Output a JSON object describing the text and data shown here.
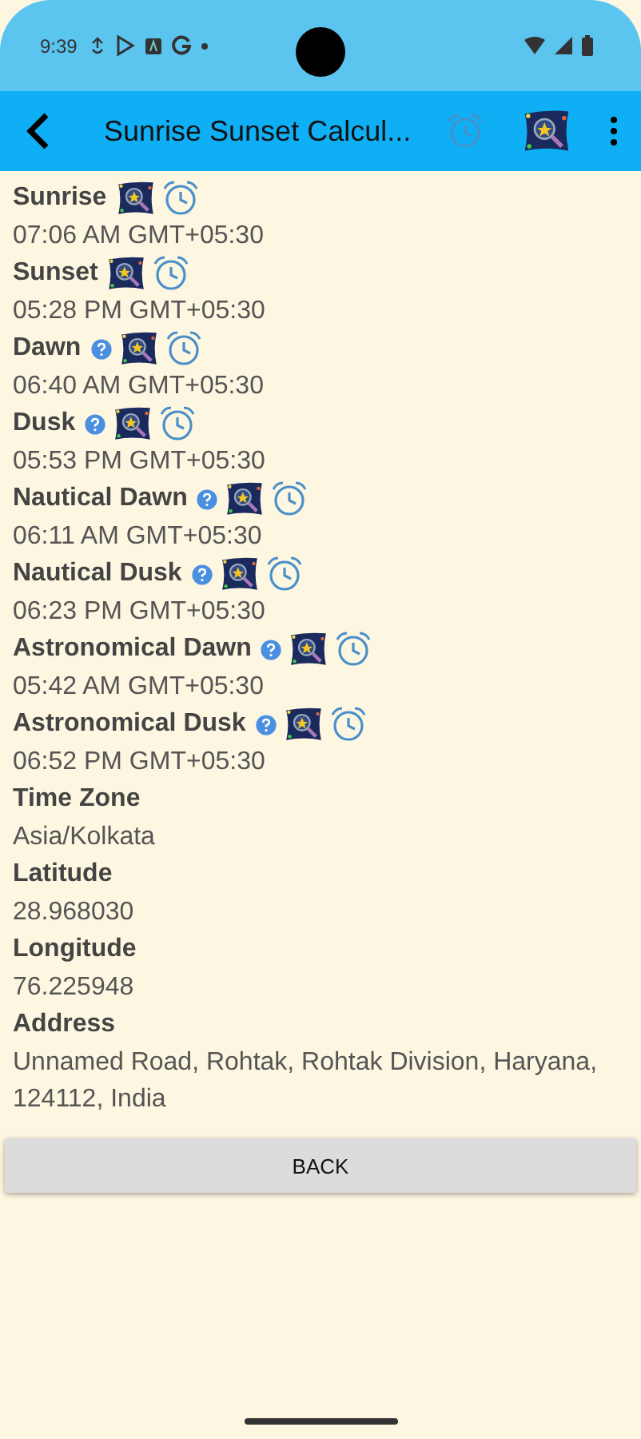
{
  "status_bar": {
    "time": "9:39"
  },
  "app_bar": {
    "title": "Sunrise Sunset Calcul..."
  },
  "events": [
    {
      "label": "Sunrise",
      "has_help": false,
      "value": "07:06 AM GMT+05:30"
    },
    {
      "label": "Sunset",
      "has_help": false,
      "value": "05:28 PM GMT+05:30"
    },
    {
      "label": "Dawn",
      "has_help": true,
      "value": "06:40 AM GMT+05:30"
    },
    {
      "label": "Dusk",
      "has_help": true,
      "value": "05:53 PM GMT+05:30"
    },
    {
      "label": "Nautical Dawn",
      "has_help": true,
      "value": "06:11 AM GMT+05:30"
    },
    {
      "label": "Nautical Dusk",
      "has_help": true,
      "value": "06:23 PM GMT+05:30"
    },
    {
      "label": "Astronomical Dawn",
      "has_help": true,
      "value": "05:42 AM GMT+05:30"
    },
    {
      "label": "Astronomical Dusk",
      "has_help": true,
      "value": "06:52 PM GMT+05:30"
    }
  ],
  "details": [
    {
      "label": "Time Zone",
      "value": "Asia/Kolkata"
    },
    {
      "label": "Latitude",
      "value": "28.968030"
    },
    {
      "label": "Longitude",
      "value": "76.225948"
    },
    {
      "label": "Address",
      "value": "Unnamed Road, Rohtak, Rohtak Division, Haryana, 124112, India"
    }
  ],
  "button": "BACK"
}
